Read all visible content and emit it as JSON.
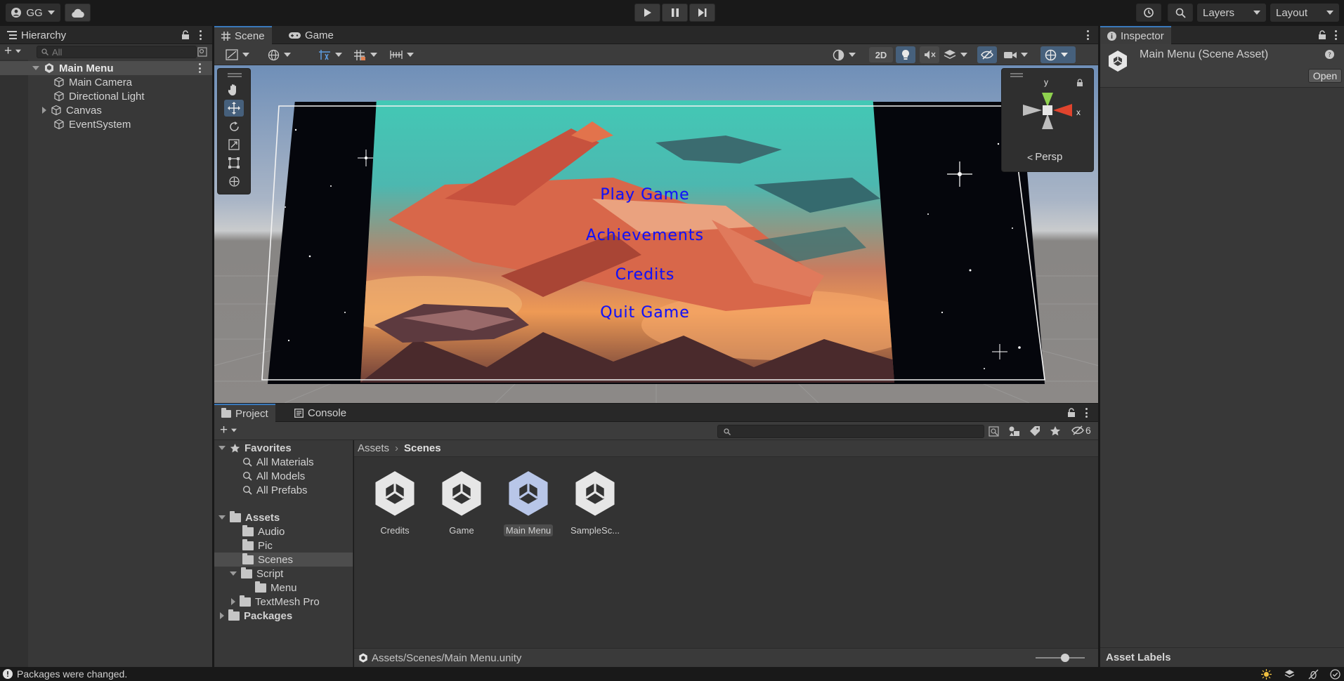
{
  "toolbar": {
    "account_label": "GG",
    "layers_label": "Layers",
    "layout_label": "Layout"
  },
  "hierarchy": {
    "tab_label": "Hierarchy",
    "search_placeholder": "All",
    "scene_name": "Main Menu",
    "items": [
      "Main Camera",
      "Directional Light",
      "Canvas",
      "EventSystem"
    ]
  },
  "scene": {
    "tab_scene": "Scene",
    "tab_game": "Game",
    "mode_2d": "2D",
    "gizmo_y": "y",
    "gizmo_x": "x",
    "persp_label": "Persp",
    "menu_buttons": [
      "Play Game",
      "Achievements",
      "Credits",
      "Quit Game"
    ]
  },
  "inspector": {
    "tab_label": "Inspector",
    "title": "Main Menu (Scene Asset)",
    "open_button": "Open",
    "asset_labels": "Asset Labels"
  },
  "project": {
    "tab_project": "Project",
    "tab_console": "Console",
    "hidden_count": "6",
    "favorites_label": "Favorites",
    "favorites": [
      "All Materials",
      "All Models",
      "All Prefabs"
    ],
    "assets_label": "Assets",
    "asset_folders": [
      "Audio",
      "Pic",
      "Scenes",
      "Script"
    ],
    "script_children": [
      "Menu"
    ],
    "textmesh": "TextMesh Pro",
    "packages_label": "Packages",
    "breadcrumb": [
      "Assets",
      "Scenes"
    ],
    "files": [
      "Credits",
      "Game",
      "Main Menu",
      "SampleSc..."
    ],
    "footer_path": "Assets/Scenes/Main Menu.unity"
  },
  "status": {
    "message": "Packages were changed."
  },
  "colors": {
    "accent": "#3a79bb",
    "menu_text": "#1010ff",
    "selection": "#4d4d4d"
  }
}
